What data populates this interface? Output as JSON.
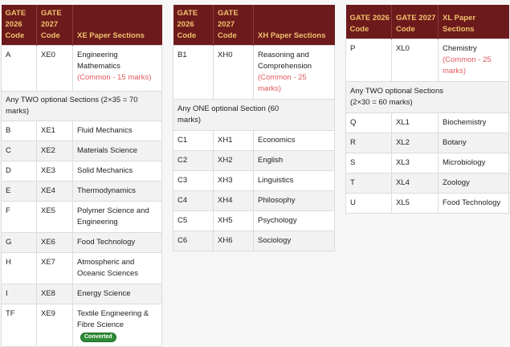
{
  "headers": {
    "gate2026": "GATE 2026 Code",
    "gate2027": "GATE 2027 Code",
    "xe": "XE Paper Sections",
    "xh": "XH Paper Sections",
    "xl": "XL Paper Sections"
  },
  "xe": {
    "compulsory": {
      "c1": "A",
      "c2": "XE0",
      "name": "Engineering Mathematics",
      "note": "(Common - 15 marks)"
    },
    "optional_note": "Any TWO optional Sections (2×35 = 70 marks)",
    "rows": [
      {
        "c1": "B",
        "c2": "XE1",
        "name": "Fluid Mechanics"
      },
      {
        "c1": "C",
        "c2": "XE2",
        "name": "Materials Science"
      },
      {
        "c1": "D",
        "c2": "XE3",
        "name": "Solid Mechanics"
      },
      {
        "c1": "E",
        "c2": "XE4",
        "name": "Thermodynamics"
      },
      {
        "c1": "F",
        "c2": "XE5",
        "name": "Polymer Science and Engineering"
      },
      {
        "c1": "G",
        "c2": "XE6",
        "name": "Food Technology"
      },
      {
        "c1": "H",
        "c2": "XE7",
        "name": "Atmospheric and Oceanic Sciences"
      },
      {
        "c1": "I",
        "c2": "XE8",
        "name": "Energy Science"
      },
      {
        "c1": "TF",
        "c2": "XE9",
        "name": "Textile Engineering & Fibre Science"
      }
    ],
    "badge": "Converted"
  },
  "xh": {
    "compulsory": {
      "c1": "B1",
      "c2": "XH0",
      "name": "Reasoning and Comprehension",
      "note": "(Common - 25 marks)"
    },
    "optional_note": "Any ONE optional Section (60 marks)",
    "rows": [
      {
        "c1": "C1",
        "c2": "XH1",
        "name": "Economics"
      },
      {
        "c1": "C2",
        "c2": "XH2",
        "name": "English"
      },
      {
        "c1": "C3",
        "c2": "XH3",
        "name": "Linguistics"
      },
      {
        "c1": "C4",
        "c2": "XH4",
        "name": "Philosophy"
      },
      {
        "c1": "C5",
        "c2": "XH5",
        "name": "Psychology"
      },
      {
        "c1": "C6",
        "c2": "XH6",
        "name": "Sociology"
      }
    ]
  },
  "xl": {
    "compulsory": {
      "c1": "P",
      "c2": "XL0",
      "name": "Chemistry",
      "note": "(Common - 25 marks)"
    },
    "optional_note": "Any TWO optional Sections (2×30 = 60 marks)",
    "rows": [
      {
        "c1": "Q",
        "c2": "XL1",
        "name": "Biochemistry"
      },
      {
        "c1": "R",
        "c2": "XL2",
        "name": "Botany"
      },
      {
        "c1": "S",
        "c2": "XL3",
        "name": "Microbiology"
      },
      {
        "c1": "T",
        "c2": "XL4",
        "name": "Zoology"
      },
      {
        "c1": "U",
        "c2": "XL5",
        "name": "Food Technology"
      }
    ]
  }
}
